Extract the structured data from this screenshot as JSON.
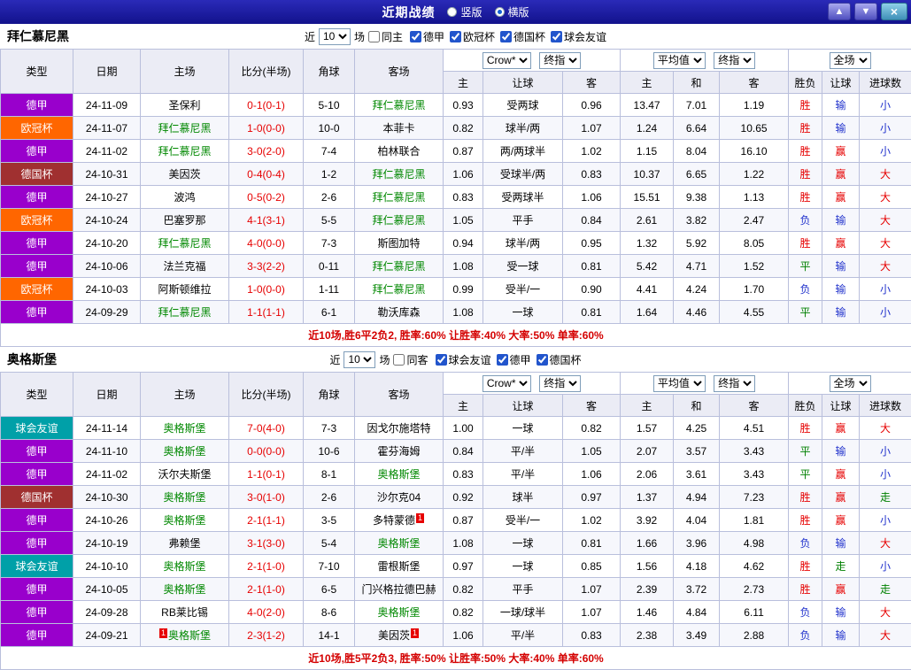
{
  "topbar": {
    "title": "近期战绩",
    "layout_options": [
      {
        "label": "竖版",
        "selected": false
      },
      {
        "label": "横版",
        "selected": true
      }
    ],
    "up_button": "▲",
    "down_button": "▼",
    "close_button": "×"
  },
  "colors": {
    "topbar_bg": "#12128c",
    "type_colors": {
      "德甲": "#9900cc",
      "欧冠杯": "#ff6600",
      "德国杯": "#a03030",
      "球会友谊": "#00a0a8"
    },
    "result_colors": {
      "胜": "#e60000",
      "平": "#008000",
      "负": "#2233cc",
      "赢": "#e60000",
      "输": "#2233cc",
      "走": "#008000",
      "大": "#e60000",
      "小": "#2233cc"
    },
    "score_color": "#e60000",
    "team_highlight": "#008800",
    "summary_color": "#d40000",
    "badge_color": "#e60000"
  },
  "table_header": {
    "static_cols": [
      "类型",
      "日期",
      "主场",
      "比分(半场)",
      "角球",
      "客场"
    ],
    "odds_group": {
      "select1": "Crow*",
      "select2": "终指"
    },
    "avg_group": {
      "select1": "平均值",
      "select2": "终指"
    },
    "scope_select": "全场",
    "sub_cols": [
      "主",
      "让球",
      "客",
      "主",
      "和",
      "客",
      "胜负",
      "让球",
      "进球数"
    ]
  },
  "sections": [
    {
      "team": "拜仁慕尼黑",
      "filter": {
        "prefix": "近",
        "count": "10",
        "suffix": "场",
        "venue": {
          "label": "同主",
          "checked": false
        },
        "leagues": [
          {
            "label": "德甲",
            "checked": true
          },
          {
            "label": "欧冠杯",
            "checked": true
          },
          {
            "label": "德国杯",
            "checked": true
          },
          {
            "label": "球会友谊",
            "checked": true
          }
        ]
      },
      "rows": [
        {
          "type": "德甲",
          "date": "24-11-09",
          "home": "圣保利",
          "home_hl": false,
          "score": "0-1(0-1)",
          "corners": "5-10",
          "away": "拜仁慕尼黑",
          "away_hl": true,
          "odds_home": "0.93",
          "handicap": "受两球",
          "odds_away": "0.96",
          "avg_home": "13.47",
          "avg_draw": "7.01",
          "avg_away": "1.19",
          "result": "胜",
          "handicap_result": "输",
          "goals_result": "小"
        },
        {
          "type": "欧冠杯",
          "date": "24-11-07",
          "home": "拜仁慕尼黑",
          "home_hl": true,
          "score": "1-0(0-0)",
          "corners": "10-0",
          "away": "本菲卡",
          "away_hl": false,
          "odds_home": "0.82",
          "handicap": "球半/两",
          "odds_away": "1.07",
          "avg_home": "1.24",
          "avg_draw": "6.64",
          "avg_away": "10.65",
          "result": "胜",
          "handicap_result": "输",
          "goals_result": "小"
        },
        {
          "type": "德甲",
          "date": "24-11-02",
          "home": "拜仁慕尼黑",
          "home_hl": true,
          "score": "3-0(2-0)",
          "corners": "7-4",
          "away": "柏林联合",
          "away_hl": false,
          "odds_home": "0.87",
          "handicap": "两/两球半",
          "odds_away": "1.02",
          "avg_home": "1.15",
          "avg_draw": "8.04",
          "avg_away": "16.10",
          "result": "胜",
          "handicap_result": "赢",
          "goals_result": "小"
        },
        {
          "type": "德国杯",
          "date": "24-10-31",
          "home": "美因茨",
          "home_hl": false,
          "score": "0-4(0-4)",
          "corners": "1-2",
          "away": "拜仁慕尼黑",
          "away_hl": true,
          "odds_home": "1.06",
          "handicap": "受球半/两",
          "odds_away": "0.83",
          "avg_home": "10.37",
          "avg_draw": "6.65",
          "avg_away": "1.22",
          "result": "胜",
          "handicap_result": "赢",
          "goals_result": "大"
        },
        {
          "type": "德甲",
          "date": "24-10-27",
          "home": "波鸿",
          "home_hl": false,
          "score": "0-5(0-2)",
          "corners": "2-6",
          "away": "拜仁慕尼黑",
          "away_hl": true,
          "odds_home": "0.83",
          "handicap": "受两球半",
          "odds_away": "1.06",
          "avg_home": "15.51",
          "avg_draw": "9.38",
          "avg_away": "1.13",
          "result": "胜",
          "handicap_result": "赢",
          "goals_result": "大"
        },
        {
          "type": "欧冠杯",
          "date": "24-10-24",
          "home": "巴塞罗那",
          "home_hl": false,
          "score": "4-1(3-1)",
          "corners": "5-5",
          "away": "拜仁慕尼黑",
          "away_hl": true,
          "odds_home": "1.05",
          "handicap": "平手",
          "odds_away": "0.84",
          "avg_home": "2.61",
          "avg_draw": "3.82",
          "avg_away": "2.47",
          "result": "负",
          "handicap_result": "输",
          "goals_result": "大"
        },
        {
          "type": "德甲",
          "date": "24-10-20",
          "home": "拜仁慕尼黑",
          "home_hl": true,
          "score": "4-0(0-0)",
          "corners": "7-3",
          "away": "斯图加特",
          "away_hl": false,
          "odds_home": "0.94",
          "handicap": "球半/两",
          "odds_away": "0.95",
          "avg_home": "1.32",
          "avg_draw": "5.92",
          "avg_away": "8.05",
          "result": "胜",
          "handicap_result": "赢",
          "goals_result": "大"
        },
        {
          "type": "德甲",
          "date": "24-10-06",
          "home": "法兰克福",
          "home_hl": false,
          "score": "3-3(2-2)",
          "corners": "0-11",
          "away": "拜仁慕尼黑",
          "away_hl": true,
          "odds_home": "1.08",
          "handicap": "受一球",
          "odds_away": "0.81",
          "avg_home": "5.42",
          "avg_draw": "4.71",
          "avg_away": "1.52",
          "result": "平",
          "handicap_result": "输",
          "goals_result": "大"
        },
        {
          "type": "欧冠杯",
          "date": "24-10-03",
          "home": "阿斯顿维拉",
          "home_hl": false,
          "score": "1-0(0-0)",
          "corners": "1-11",
          "away": "拜仁慕尼黑",
          "away_hl": true,
          "odds_home": "0.99",
          "handicap": "受半/一",
          "odds_away": "0.90",
          "avg_home": "4.41",
          "avg_draw": "4.24",
          "avg_away": "1.70",
          "result": "负",
          "handicap_result": "输",
          "goals_result": "小"
        },
        {
          "type": "德甲",
          "date": "24-09-29",
          "home": "拜仁慕尼黑",
          "home_hl": true,
          "score": "1-1(1-1)",
          "corners": "6-1",
          "away": "勒沃库森",
          "away_hl": false,
          "odds_home": "1.08",
          "handicap": "一球",
          "odds_away": "0.81",
          "avg_home": "1.64",
          "avg_draw": "4.46",
          "avg_away": "4.55",
          "result": "平",
          "handicap_result": "输",
          "goals_result": "小"
        }
      ],
      "summary": "近10场,胜6平2负2, 胜率:60% 让胜率:40% 大率:50% 单率:60%"
    },
    {
      "team": "奥格斯堡",
      "filter": {
        "prefix": "近",
        "count": "10",
        "suffix": "场",
        "venue": {
          "label": "同客",
          "checked": false
        },
        "leagues": [
          {
            "label": "球会友谊",
            "checked": true
          },
          {
            "label": "德甲",
            "checked": true
          },
          {
            "label": "德国杯",
            "checked": true
          }
        ]
      },
      "rows": [
        {
          "type": "球会友谊",
          "date": "24-11-14",
          "home": "奥格斯堡",
          "home_hl": true,
          "score": "7-0(4-0)",
          "corners": "7-3",
          "away": "因戈尔施塔特",
          "away_hl": false,
          "odds_home": "1.00",
          "handicap": "一球",
          "odds_away": "0.82",
          "avg_home": "1.57",
          "avg_draw": "4.25",
          "avg_away": "4.51",
          "result": "胜",
          "handicap_result": "赢",
          "goals_result": "大"
        },
        {
          "type": "德甲",
          "date": "24-11-10",
          "home": "奥格斯堡",
          "home_hl": true,
          "score": "0-0(0-0)",
          "corners": "10-6",
          "away": "霍芬海姆",
          "away_hl": false,
          "odds_home": "0.84",
          "handicap": "平/半",
          "odds_away": "1.05",
          "avg_home": "2.07",
          "avg_draw": "3.57",
          "avg_away": "3.43",
          "result": "平",
          "handicap_result": "输",
          "goals_result": "小"
        },
        {
          "type": "德甲",
          "date": "24-11-02",
          "home": "沃尔夫斯堡",
          "home_hl": false,
          "score": "1-1(0-1)",
          "corners": "8-1",
          "away": "奥格斯堡",
          "away_hl": true,
          "odds_home": "0.83",
          "handicap": "平/半",
          "odds_away": "1.06",
          "avg_home": "2.06",
          "avg_draw": "3.61",
          "avg_away": "3.43",
          "result": "平",
          "handicap_result": "赢",
          "goals_result": "小"
        },
        {
          "type": "德国杯",
          "date": "24-10-30",
          "home": "奥格斯堡",
          "home_hl": true,
          "score": "3-0(1-0)",
          "corners": "2-6",
          "away": "沙尔克04",
          "away_hl": false,
          "odds_home": "0.92",
          "handicap": "球半",
          "odds_away": "0.97",
          "avg_home": "1.37",
          "avg_draw": "4.94",
          "avg_away": "7.23",
          "result": "胜",
          "handicap_result": "赢",
          "goals_result": "走"
        },
        {
          "type": "德甲",
          "date": "24-10-26",
          "home": "奥格斯堡",
          "home_hl": true,
          "score": "2-1(1-1)",
          "corners": "3-5",
          "away": "多特蒙德",
          "away_hl": false,
          "away_badge": "1",
          "odds_home": "0.87",
          "handicap": "受半/一",
          "odds_away": "1.02",
          "avg_home": "3.92",
          "avg_draw": "4.04",
          "avg_away": "1.81",
          "result": "胜",
          "handicap_result": "赢",
          "goals_result": "小"
        },
        {
          "type": "德甲",
          "date": "24-10-19",
          "home": "弗赖堡",
          "home_hl": false,
          "score": "3-1(3-0)",
          "corners": "5-4",
          "away": "奥格斯堡",
          "away_hl": true,
          "odds_home": "1.08",
          "handicap": "一球",
          "odds_away": "0.81",
          "avg_home": "1.66",
          "avg_draw": "3.96",
          "avg_away": "4.98",
          "result": "负",
          "handicap_result": "输",
          "goals_result": "大"
        },
        {
          "type": "球会友谊",
          "date": "24-10-10",
          "home": "奥格斯堡",
          "home_hl": true,
          "score": "2-1(1-0)",
          "corners": "7-10",
          "away": "雷根斯堡",
          "away_hl": false,
          "odds_home": "0.97",
          "handicap": "一球",
          "odds_away": "0.85",
          "avg_home": "1.56",
          "avg_draw": "4.18",
          "avg_away": "4.62",
          "result": "胜",
          "handicap_result": "走",
          "goals_result": "小"
        },
        {
          "type": "德甲",
          "date": "24-10-05",
          "home": "奥格斯堡",
          "home_hl": true,
          "score": "2-1(1-0)",
          "corners": "6-5",
          "away": "门兴格拉德巴赫",
          "away_hl": false,
          "odds_home": "0.82",
          "handicap": "平手",
          "odds_away": "1.07",
          "avg_home": "2.39",
          "avg_draw": "3.72",
          "avg_away": "2.73",
          "result": "胜",
          "handicap_result": "赢",
          "goals_result": "走"
        },
        {
          "type": "德甲",
          "date": "24-09-28",
          "home": "RB莱比锡",
          "home_hl": false,
          "score": "4-0(2-0)",
          "corners": "8-6",
          "away": "奥格斯堡",
          "away_hl": true,
          "odds_home": "0.82",
          "handicap": "一球/球半",
          "odds_away": "1.07",
          "avg_home": "1.46",
          "avg_draw": "4.84",
          "avg_away": "6.11",
          "result": "负",
          "handicap_result": "输",
          "goals_result": "大"
        },
        {
          "type": "德甲",
          "date": "24-09-21",
          "home": "奥格斯堡",
          "home_hl": true,
          "home_badge_pre": "1",
          "score": "2-3(1-2)",
          "corners": "14-1",
          "away": "美因茨",
          "away_hl": false,
          "away_badge": "1",
          "odds_home": "1.06",
          "handicap": "平/半",
          "odds_away": "0.83",
          "avg_home": "2.38",
          "avg_draw": "3.49",
          "avg_away": "2.88",
          "result": "负",
          "handicap_result": "输",
          "goals_result": "大"
        }
      ],
      "summary": "近10场,胜5平2负3, 胜率:50% 让胜率:50% 大率:40% 单率:60%"
    }
  ]
}
